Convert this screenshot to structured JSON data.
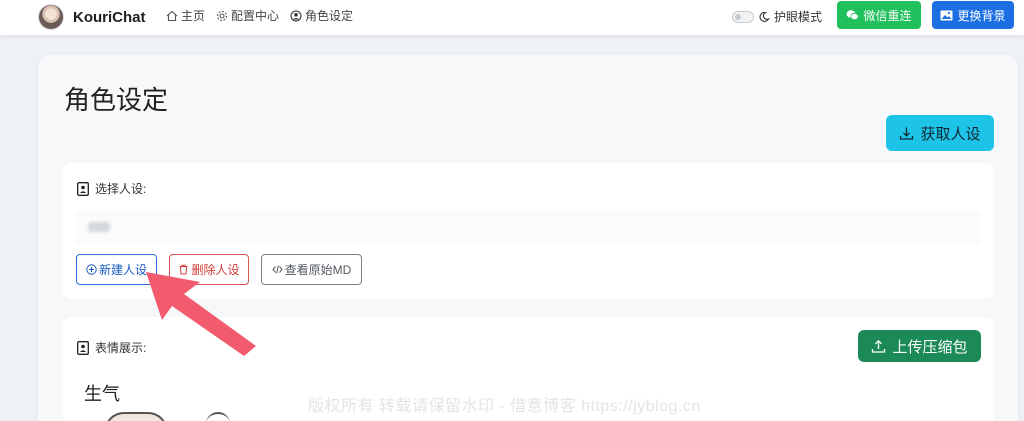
{
  "nav": {
    "brand": "KouriChat",
    "links": [
      "主页",
      "配置中心",
      "角色设定"
    ],
    "eye_mode": "护眼模式",
    "wechat_reconnect": "微信重连",
    "change_bg": "更换背景"
  },
  "page": {
    "title": "角色设定",
    "fetch_button": "获取人设"
  },
  "persona_panel": {
    "label": "选择人设:",
    "selected_value": "",
    "buttons": {
      "new": "新建人设",
      "delete": "删除人设",
      "view_md": "查看原始MD"
    }
  },
  "emotion_panel": {
    "label": "表情展示:",
    "upload_button": "上传压缩包",
    "section_title": "生气"
  },
  "watermark": "版权所有 转载请保留水印 - 借意博客 https://jyblog.cn",
  "colors": {
    "wechat_green": "#20c05c",
    "change_bg_blue": "#1b6fe3",
    "fetch_cyan": "#1ec3e8",
    "upload_green": "#1b8a57",
    "annotation_arrow": "#f25a6e"
  }
}
